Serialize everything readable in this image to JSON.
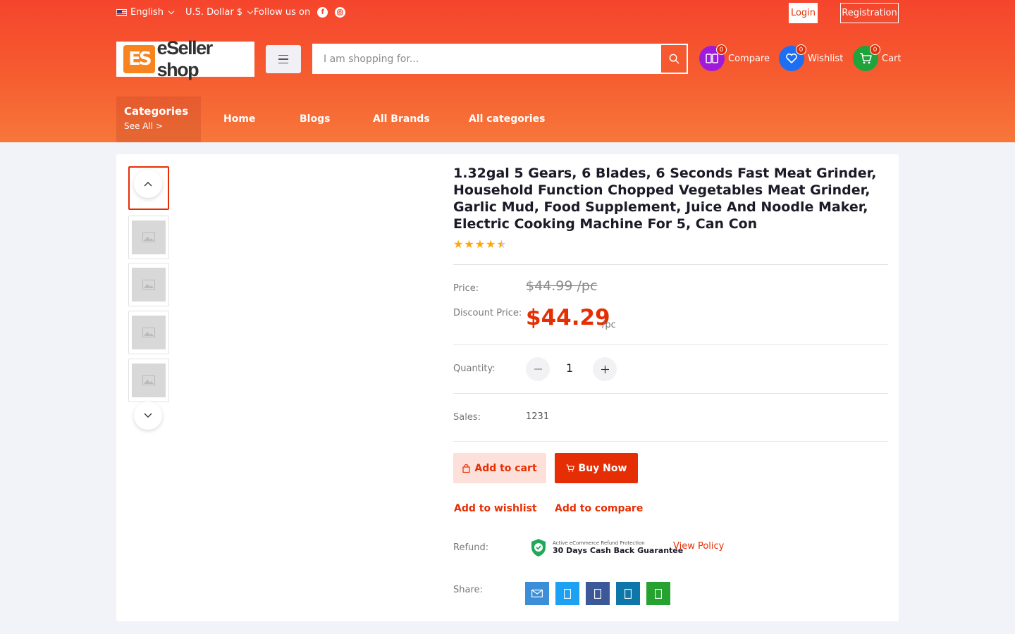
{
  "topbar": {
    "language": "English",
    "currency": "U.S. Dollar $",
    "follow_text": "Follow us on",
    "social": [
      "facebook-icon",
      "instagram-icon"
    ],
    "login": "Login",
    "registration": "Registration"
  },
  "brand": {
    "logo_mark": "ES",
    "logo_text": "eSeller shop",
    "colors": {
      "primary": "#e62e04",
      "header_top": "#f5452d",
      "header_bottom": "#f7773a"
    }
  },
  "search": {
    "placeholder": "I am shopping for..."
  },
  "actions": {
    "compare": {
      "label": "Compare",
      "count": "0",
      "color": "#9d1bd9"
    },
    "wishlist": {
      "label": "Wishlist",
      "count": "0",
      "color": "#1c6ef2"
    },
    "cart": {
      "label": "Cart",
      "count": "0",
      "color": "#1fa33a"
    }
  },
  "nav": {
    "categories_title": "Categories",
    "categories_sub": "See All >",
    "links": [
      "Home",
      "Blogs",
      "All Brands",
      "All categories"
    ]
  },
  "product": {
    "title": "1.32gal 5 Gears, 6 Blades, 6 Seconds Fast Meat Grinder, Household Function Chopped Vegetables Meat Grinder, Garlic Mud, Food Supplement, Juice And Noodle Maker, Electric Cooking Machine For 5, Can Con",
    "rating": 4.5,
    "price_label": "Price:",
    "price": "$44.99 /pc",
    "discount_label": "Discount Price:",
    "discount_price": "$44.29",
    "unit": "/pc",
    "quantity_label": "Quantity:",
    "quantity": "1",
    "sales_label": "Sales:",
    "sales": "1231",
    "add_to_cart": "Add to cart",
    "buy_now": "Buy Now",
    "add_to_wishlist": "Add to wishlist",
    "add_to_compare": "Add to compare",
    "refund_label": "Refund:",
    "refund_small": "Active eCommerce Refund Protection",
    "refund_big": "30 Days Cash Back Guarantee",
    "view_policy": "View Policy",
    "share_label": "Share:",
    "share_buttons": [
      {
        "icon": "email-icon",
        "color": "#3b8fd9"
      },
      {
        "icon": "twitter-icon",
        "color": "#1da1f2"
      },
      {
        "icon": "facebook-icon",
        "color": "#3b5998"
      },
      {
        "icon": "linkedin-icon",
        "color": "#0e76a8"
      },
      {
        "icon": "whatsapp-icon",
        "color": "#25a22f"
      }
    ]
  },
  "gallery": {
    "thumbnail_count": 5,
    "active_index": 0
  }
}
